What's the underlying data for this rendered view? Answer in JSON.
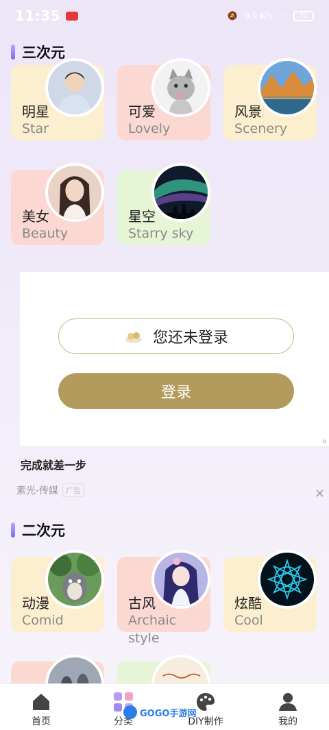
{
  "status_bar": {
    "time": "11:35",
    "battery": "71",
    "net_speed": "9.9 K/s"
  },
  "sections": [
    {
      "title": "三次元"
    },
    {
      "title": "二次元"
    }
  ],
  "three_d": [
    {
      "cn": "明星",
      "en": "Star",
      "color": "yellow",
      "icon": "portrait-man-image"
    },
    {
      "cn": "可爱",
      "en": "Lovely",
      "color": "pink",
      "icon": "kitten-image"
    },
    {
      "cn": "风景",
      "en": "Scenery",
      "color": "yellow",
      "icon": "mountain-lake-image"
    },
    {
      "cn": "美女",
      "en": "Beauty",
      "color": "pink",
      "icon": "portrait-woman-image"
    },
    {
      "cn": "星空",
      "en": "Starry sky",
      "color": "green",
      "icon": "aurora-sky-image"
    }
  ],
  "two_d": [
    {
      "cn": "动漫",
      "en": "Comid",
      "color": "yellow",
      "icon": "anime-forest-image"
    },
    {
      "cn": "古风",
      "en": "Archaic style",
      "color": "pink",
      "icon": "anime-girl-image"
    },
    {
      "cn": "炫酷",
      "en": "Cool",
      "color": "yellow",
      "icon": "neon-mandala-image"
    }
  ],
  "ad": {
    "status_text": "您还未登录",
    "login_label": "登录",
    "caption": "完成就差一步",
    "source": "素光-传媒",
    "tag": "广告",
    "close": "×"
  },
  "tabs": [
    {
      "label": "首页",
      "icon": "home-icon"
    },
    {
      "label": "分类",
      "icon": "category-icon"
    },
    {
      "label": "DIY制作",
      "icon": "palette-icon"
    },
    {
      "label": "我的",
      "icon": "profile-icon"
    }
  ],
  "watermark": "GOGO手游网",
  "colors": {
    "accent": "#b39b5e",
    "yellow_card": "#fcefd0",
    "pink_card": "#fbd8d1",
    "green_card": "#e5f5d6"
  }
}
